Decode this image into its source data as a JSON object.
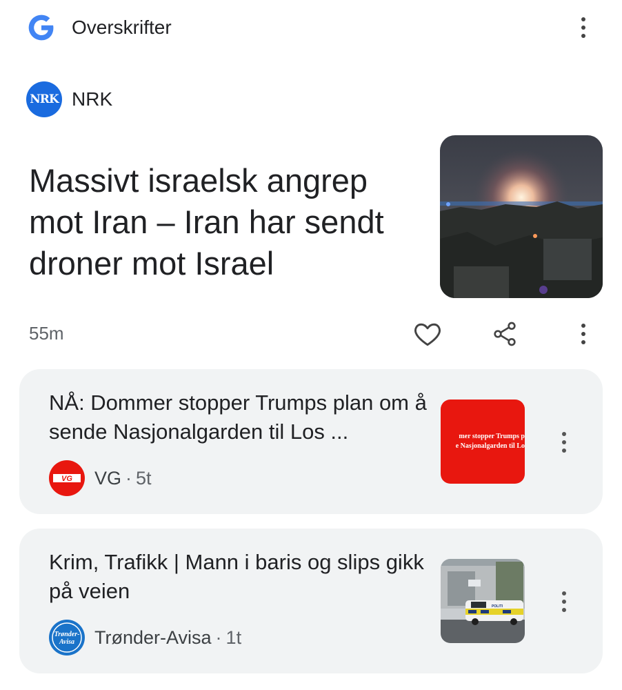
{
  "header": {
    "title": "Overskrifter",
    "logo_icon": "google-g-icon",
    "menu_icon": "more-vert-icon"
  },
  "top_story": {
    "source": "NRK",
    "source_logo_text": "NRK",
    "headline": "Massivt israelsk angrep mot Iran – Iran har sendt droner mot Israel",
    "age": "55m",
    "image": "night-explosion-photo",
    "actions": [
      "heart-icon",
      "share-icon",
      "more-vert-icon"
    ]
  },
  "stories": [
    {
      "title": "NÅ: Dommer stopper Trumps plan om å sende Nasjonalgarden til Los ...",
      "source": "VG",
      "source_logo_text": "VG",
      "time": "5t",
      "thumb_lines": [
        "mer stopper Trumps p",
        "e Nasjonalgarden til Lo"
      ],
      "brand_color": "#e8170f"
    },
    {
      "title": "Krim, Trafikk | Mann i baris og slips gikk på veien",
      "source": "Trønder-Avisa",
      "source_logo_text": [
        "Trønder-",
        "Avisa"
      ],
      "time": "1t",
      "thumb_text": "POLITI",
      "brand_color": "#1a73c9"
    }
  ],
  "separator": "·",
  "colors": {
    "accent_blue": "#4285f4",
    "nrk_blue": "#1a6bdf",
    "card_bg": "#f1f3f4",
    "muted_text": "#5f6368"
  }
}
